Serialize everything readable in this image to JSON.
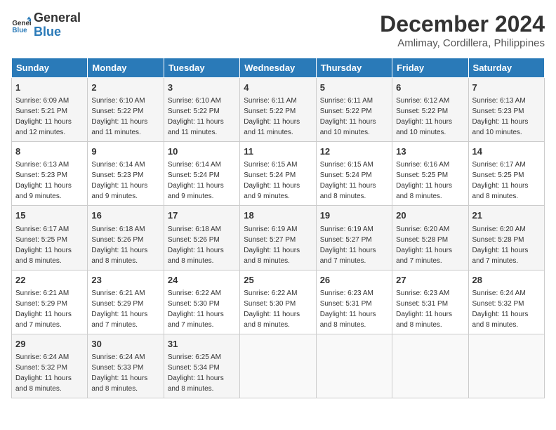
{
  "logo": {
    "general": "General",
    "blue": "Blue"
  },
  "title": "December 2024",
  "location": "Amlimay, Cordillera, Philippines",
  "days_of_week": [
    "Sunday",
    "Monday",
    "Tuesday",
    "Wednesday",
    "Thursday",
    "Friday",
    "Saturday"
  ],
  "weeks": [
    [
      {
        "day": "1",
        "sunrise": "6:09 AM",
        "sunset": "5:21 PM",
        "daylight": "11 hours and 12 minutes."
      },
      {
        "day": "2",
        "sunrise": "6:10 AM",
        "sunset": "5:22 PM",
        "daylight": "11 hours and 11 minutes."
      },
      {
        "day": "3",
        "sunrise": "6:10 AM",
        "sunset": "5:22 PM",
        "daylight": "11 hours and 11 minutes."
      },
      {
        "day": "4",
        "sunrise": "6:11 AM",
        "sunset": "5:22 PM",
        "daylight": "11 hours and 11 minutes."
      },
      {
        "day": "5",
        "sunrise": "6:11 AM",
        "sunset": "5:22 PM",
        "daylight": "11 hours and 10 minutes."
      },
      {
        "day": "6",
        "sunrise": "6:12 AM",
        "sunset": "5:22 PM",
        "daylight": "11 hours and 10 minutes."
      },
      {
        "day": "7",
        "sunrise": "6:13 AM",
        "sunset": "5:23 PM",
        "daylight": "11 hours and 10 minutes."
      }
    ],
    [
      {
        "day": "8",
        "sunrise": "6:13 AM",
        "sunset": "5:23 PM",
        "daylight": "11 hours and 9 minutes."
      },
      {
        "day": "9",
        "sunrise": "6:14 AM",
        "sunset": "5:23 PM",
        "daylight": "11 hours and 9 minutes."
      },
      {
        "day": "10",
        "sunrise": "6:14 AM",
        "sunset": "5:24 PM",
        "daylight": "11 hours and 9 minutes."
      },
      {
        "day": "11",
        "sunrise": "6:15 AM",
        "sunset": "5:24 PM",
        "daylight": "11 hours and 9 minutes."
      },
      {
        "day": "12",
        "sunrise": "6:15 AM",
        "sunset": "5:24 PM",
        "daylight": "11 hours and 8 minutes."
      },
      {
        "day": "13",
        "sunrise": "6:16 AM",
        "sunset": "5:25 PM",
        "daylight": "11 hours and 8 minutes."
      },
      {
        "day": "14",
        "sunrise": "6:17 AM",
        "sunset": "5:25 PM",
        "daylight": "11 hours and 8 minutes."
      }
    ],
    [
      {
        "day": "15",
        "sunrise": "6:17 AM",
        "sunset": "5:25 PM",
        "daylight": "11 hours and 8 minutes."
      },
      {
        "day": "16",
        "sunrise": "6:18 AM",
        "sunset": "5:26 PM",
        "daylight": "11 hours and 8 minutes."
      },
      {
        "day": "17",
        "sunrise": "6:18 AM",
        "sunset": "5:26 PM",
        "daylight": "11 hours and 8 minutes."
      },
      {
        "day": "18",
        "sunrise": "6:19 AM",
        "sunset": "5:27 PM",
        "daylight": "11 hours and 8 minutes."
      },
      {
        "day": "19",
        "sunrise": "6:19 AM",
        "sunset": "5:27 PM",
        "daylight": "11 hours and 7 minutes."
      },
      {
        "day": "20",
        "sunrise": "6:20 AM",
        "sunset": "5:28 PM",
        "daylight": "11 hours and 7 minutes."
      },
      {
        "day": "21",
        "sunrise": "6:20 AM",
        "sunset": "5:28 PM",
        "daylight": "11 hours and 7 minutes."
      }
    ],
    [
      {
        "day": "22",
        "sunrise": "6:21 AM",
        "sunset": "5:29 PM",
        "daylight": "11 hours and 7 minutes."
      },
      {
        "day": "23",
        "sunrise": "6:21 AM",
        "sunset": "5:29 PM",
        "daylight": "11 hours and 7 minutes."
      },
      {
        "day": "24",
        "sunrise": "6:22 AM",
        "sunset": "5:30 PM",
        "daylight": "11 hours and 7 minutes."
      },
      {
        "day": "25",
        "sunrise": "6:22 AM",
        "sunset": "5:30 PM",
        "daylight": "11 hours and 8 minutes."
      },
      {
        "day": "26",
        "sunrise": "6:23 AM",
        "sunset": "5:31 PM",
        "daylight": "11 hours and 8 minutes."
      },
      {
        "day": "27",
        "sunrise": "6:23 AM",
        "sunset": "5:31 PM",
        "daylight": "11 hours and 8 minutes."
      },
      {
        "day": "28",
        "sunrise": "6:24 AM",
        "sunset": "5:32 PM",
        "daylight": "11 hours and 8 minutes."
      }
    ],
    [
      {
        "day": "29",
        "sunrise": "6:24 AM",
        "sunset": "5:32 PM",
        "daylight": "11 hours and 8 minutes."
      },
      {
        "day": "30",
        "sunrise": "6:24 AM",
        "sunset": "5:33 PM",
        "daylight": "11 hours and 8 minutes."
      },
      {
        "day": "31",
        "sunrise": "6:25 AM",
        "sunset": "5:34 PM",
        "daylight": "11 hours and 8 minutes."
      },
      null,
      null,
      null,
      null
    ]
  ]
}
